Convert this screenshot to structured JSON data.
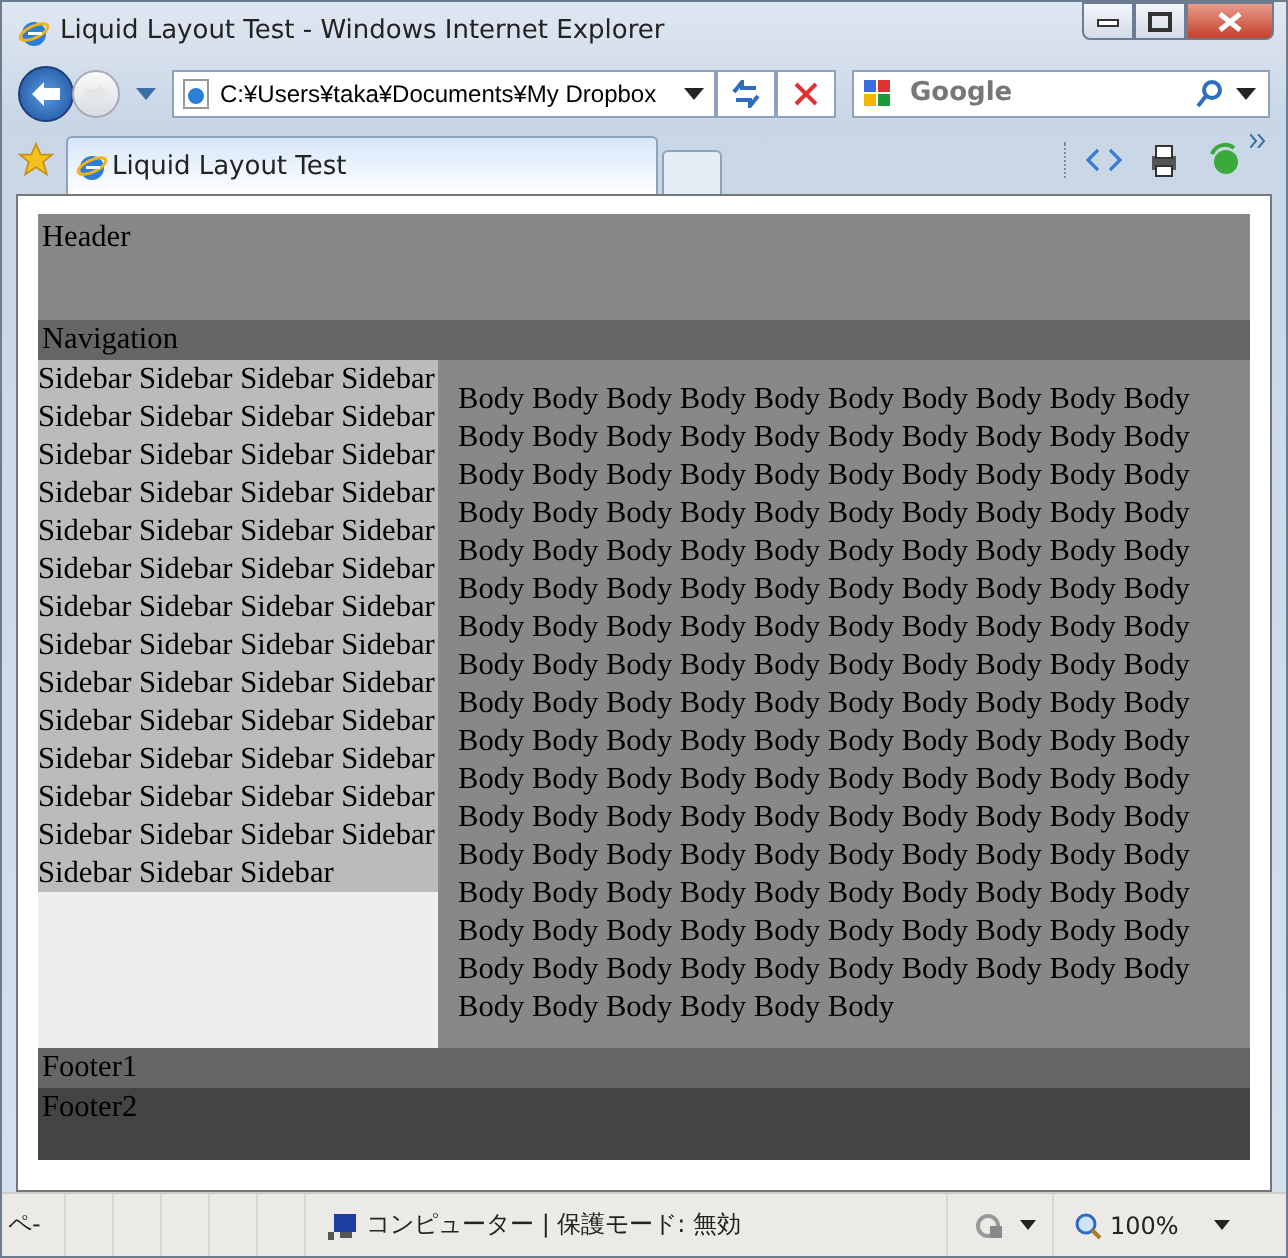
{
  "window": {
    "title": "Liquid Layout Test - Windows Internet Explorer"
  },
  "address_bar": {
    "value": "C:¥Users¥taka¥Documents¥My Dropbox"
  },
  "search": {
    "placeholder": "Google"
  },
  "tabs": [
    {
      "label": "Liquid Layout Test",
      "selected": true
    }
  ],
  "page": {
    "header": "Header",
    "navigation": "Navigation",
    "sidebar": "Sidebar Sidebar Sidebar Sidebar Sidebar Sidebar Sidebar Sidebar Sidebar Sidebar Sidebar Sidebar Sidebar Sidebar Sidebar Sidebar Sidebar Sidebar Sidebar Sidebar Sidebar Sidebar Sidebar Sidebar Sidebar Sidebar Sidebar Sidebar Sidebar Sidebar Sidebar Sidebar Sidebar Sidebar Sidebar Sidebar Sidebar Sidebar Sidebar Sidebar Sidebar Sidebar Sidebar Sidebar Sidebar Sidebar Sidebar Sidebar Sidebar Sidebar Sidebar Sidebar Sidebar Sidebar Sidebar",
    "body": "Body Body Body Body Body Body Body Body Body Body Body Body Body Body Body Body Body Body Body Body Body Body Body Body Body Body Body Body Body Body Body Body Body Body Body Body Body Body Body Body Body Body Body Body Body Body Body Body Body Body Body Body Body Body Body Body Body Body Body Body Body Body Body Body Body Body Body Body Body Body Body Body Body Body Body Body Body Body Body Body Body Body Body Body Body Body Body Body Body Body Body Body Body Body Body Body Body Body Body Body Body Body Body Body Body Body Body Body Body Body Body Body Body Body Body Body Body Body Body Body Body Body Body Body Body Body Body Body Body Body Body Body Body Body Body Body Body Body Body Body Body Body Body Body Body Body Body Body Body Body Body Body Body Body Body Body Body Body Body Body Body Body Body Body Body Body",
    "footer1": "Footer1",
    "footer2": "Footer2"
  },
  "status_bar": {
    "progress": "ペ-",
    "zone": "コンピューター | 保護モード: 無効",
    "zoom": "100%"
  }
}
